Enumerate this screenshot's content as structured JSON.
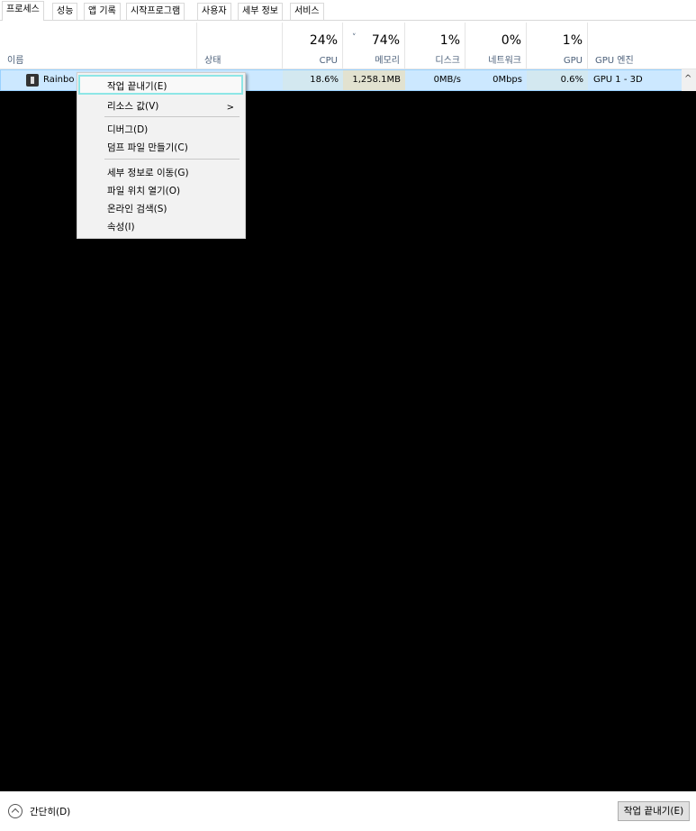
{
  "tabs": [
    "프로세스",
    "성능",
    "앱 기록",
    "시작프로그램",
    "사용자",
    "세부 정보",
    "서비스"
  ],
  "columns": {
    "name": "이름",
    "status": "상태",
    "cpu": {
      "pct": "24%",
      "label": "CPU"
    },
    "memory": {
      "pct": "74%",
      "label": "메모리",
      "sort": "˅"
    },
    "disk": {
      "pct": "1%",
      "label": "디스크"
    },
    "network": {
      "pct": "0%",
      "label": "네트워크"
    },
    "gpu": {
      "pct": "1%",
      "label": "GPU"
    },
    "gpu_engine": "GPU 엔진"
  },
  "process_row": {
    "name": "Rainbo",
    "cpu": "18.6%",
    "memory": "1,258.1MB",
    "disk": "0MB/s",
    "network": "0Mbps",
    "gpu": "0.6%",
    "gpu_engine": "GPU 1 - 3D",
    "icon": "app-icon"
  },
  "context_menu": {
    "items": [
      "작업 끝내기(E)",
      "리소스 값(V)",
      "디버그(D)",
      "덤프 파일 만들기(C)",
      "세부 정보로 이동(G)",
      "파일 위치 열기(O)",
      "온라인 검색(S)",
      "속성(I)"
    ],
    "submenu_arrow": ">"
  },
  "footer": {
    "fewer_details": "간단히(D)",
    "end_task": "작업 끝내기(E)"
  },
  "scroll_up": "^",
  "colors": {
    "selected_row": "#cce8ff",
    "highlight_border": "#8ee6e6",
    "header_label": "#4c607a"
  }
}
